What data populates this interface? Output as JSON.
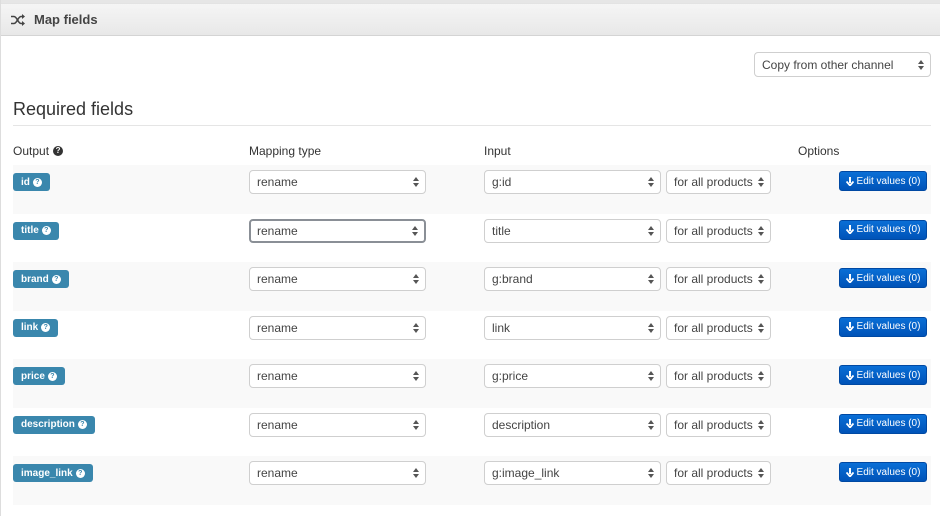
{
  "panel": {
    "title": "Map fields",
    "icon": "shuffle-icon"
  },
  "copy_select": {
    "value": "Copy from other channel"
  },
  "section": {
    "title": "Required fields"
  },
  "columns": {
    "output": "Output",
    "mapping_type": "Mapping type",
    "input": "Input",
    "options": "Options"
  },
  "help_glyph": "?",
  "rows": [
    {
      "field": "id",
      "mapping": "rename",
      "input": "g:id",
      "scope": "for all products",
      "button": "Edit values (0)"
    },
    {
      "field": "title",
      "mapping": "rename",
      "input": "title",
      "scope": "for all products",
      "button": "Edit values (0)"
    },
    {
      "field": "brand",
      "mapping": "rename",
      "input": "g:brand",
      "scope": "for all products",
      "button": "Edit values (0)"
    },
    {
      "field": "link",
      "mapping": "rename",
      "input": "link",
      "scope": "for all products",
      "button": "Edit values (0)"
    },
    {
      "field": "price",
      "mapping": "rename",
      "input": "g:price",
      "scope": "for all products",
      "button": "Edit values (0)"
    },
    {
      "field": "description",
      "mapping": "rename",
      "input": "description",
      "scope": "for all products",
      "button": "Edit values (0)"
    },
    {
      "field": "image_link",
      "mapping": "rename",
      "input": "g:image_link",
      "scope": "for all products",
      "button": "Edit values (0)"
    }
  ],
  "colors": {
    "label_bg": "#3a87ad",
    "button_bg": "#0a6fd6",
    "stripe_bg": "#f9f9f9"
  }
}
